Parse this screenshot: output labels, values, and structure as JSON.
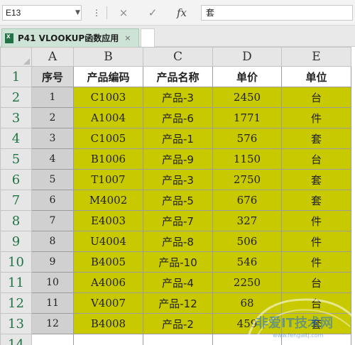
{
  "formula_bar": {
    "name_box": "E13",
    "more_icon": "vertical-dots",
    "cancel_icon": "×",
    "confirm_icon": "✓",
    "fx_label": "fx",
    "formula": "套"
  },
  "tab": {
    "title": "P41 VLOOKUP函数应用",
    "close": "×"
  },
  "columns": [
    "A",
    "B",
    "C",
    "D",
    "E"
  ],
  "header_row": {
    "row_num": "1",
    "cells": [
      "序号",
      "产品编码",
      "产品名称",
      "单价",
      "单位"
    ]
  },
  "rows": [
    {
      "row_num": "2",
      "cells": [
        "1",
        "C1003",
        "产品-3",
        "2450",
        "台"
      ]
    },
    {
      "row_num": "3",
      "cells": [
        "2",
        "A1004",
        "产品-6",
        "1771",
        "件"
      ]
    },
    {
      "row_num": "4",
      "cells": [
        "3",
        "C1005",
        "产品-1",
        "576",
        "套"
      ]
    },
    {
      "row_num": "5",
      "cells": [
        "4",
        "B1006",
        "产品-9",
        "1150",
        "台"
      ]
    },
    {
      "row_num": "6",
      "cells": [
        "5",
        "T1007",
        "产品-3",
        "2750",
        "套"
      ]
    },
    {
      "row_num": "7",
      "cells": [
        "6",
        "M4002",
        "产品-5",
        "676",
        "套"
      ]
    },
    {
      "row_num": "8",
      "cells": [
        "7",
        "E4003",
        "产品-7",
        "327",
        "件"
      ]
    },
    {
      "row_num": "9",
      "cells": [
        "8",
        "U4004",
        "产品-8",
        "506",
        "件"
      ]
    },
    {
      "row_num": "10",
      "cells": [
        "9",
        "B4005",
        "产品-10",
        "546",
        "件"
      ]
    },
    {
      "row_num": "11",
      "cells": [
        "10",
        "A4006",
        "产品-4",
        "2250",
        "台"
      ]
    },
    {
      "row_num": "12",
      "cells": [
        "11",
        "V4007",
        "产品-12",
        "68",
        "台"
      ]
    },
    {
      "row_num": "13",
      "cells": [
        "12",
        "B4008",
        "产品-2",
        "459",
        "套"
      ]
    }
  ],
  "partial_row": {
    "row_num": "14"
  },
  "colors": {
    "fill_yellow": "#c9c900",
    "fill_gray": "#d0d0d0",
    "row_number": "#217346",
    "tab_active": "#cde3d6"
  },
  "watermark": {
    "text": "非爱IT技术网",
    "subtext": "www.fengaitj.com"
  }
}
